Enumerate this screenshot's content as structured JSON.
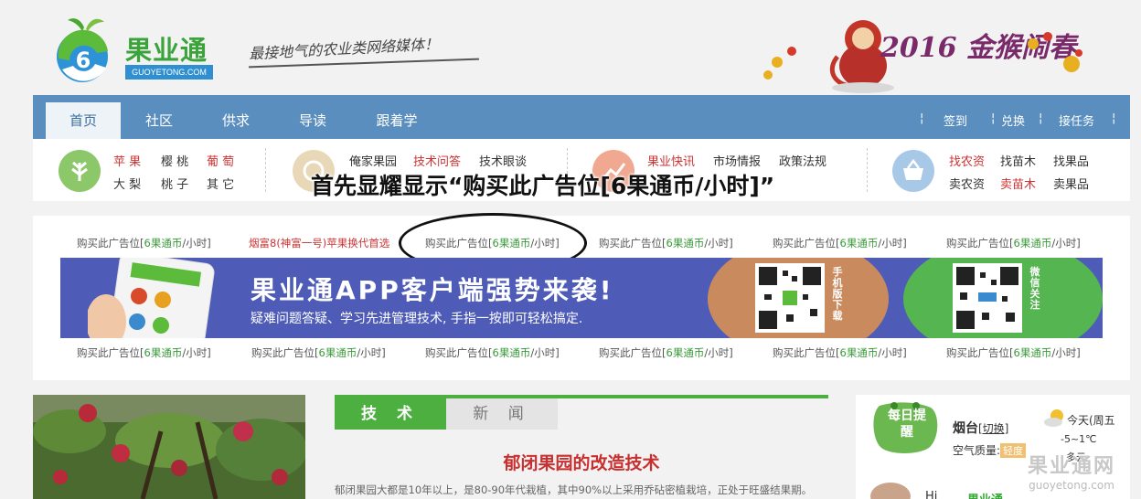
{
  "header": {
    "logo_name": "果业通",
    "logo_domain": "GUOYETONG.COM",
    "slogan": "最接地气的农业类网络媒体！",
    "festive_text": "2016 金猴闹春"
  },
  "nav": {
    "items": [
      {
        "label": "首页",
        "active": true
      },
      {
        "label": "社区"
      },
      {
        "label": "供求"
      },
      {
        "label": "导读"
      },
      {
        "label": "跟着学"
      }
    ],
    "right": [
      "签到",
      "兑换",
      "接任务"
    ]
  },
  "categories": {
    "group1": [
      "苹 果",
      "樱 桃",
      "葡 萄",
      "大 梨",
      "桃 子",
      "其 它"
    ],
    "group2": [
      "俺家果园",
      "技术问答",
      "技术眼谈"
    ],
    "group3": [
      "果业快讯",
      "市场情报",
      "政策法规"
    ],
    "group4": [
      "找农资",
      "找苗木",
      "找果品",
      "卖农资",
      "卖苗木",
      "卖果品"
    ]
  },
  "overlay_caption": "首先显耀显示“购买此广告位[6果通币/小时]”",
  "ads": {
    "prefix": "购买此广告位[",
    "coin": "6果通币",
    "suffix": "/小时]",
    "special": "烟富8(神富一号)苹果换代首选"
  },
  "banner": {
    "title": "果业通APP客户端强势来袭!",
    "subtitle": "疑难问题答疑、学习先进管理技术, 手指一按即可轻松搞定.",
    "mobile_label": "手机版下载",
    "wechat_label": "微信关注"
  },
  "tabs": {
    "tech": "技 术",
    "news": "新 闻"
  },
  "article": {
    "title": "郁闭果园的改造技术",
    "text": "郁闭果园大都是10年以上，是80-90年代栽植，其中90%以上采用乔砧密植栽培，正处于旺盛结果期。"
  },
  "sidebar": {
    "daily": "每日提醒",
    "city": "烟台",
    "switch": "[切换]",
    "air_label": "空气质量:",
    "air_value": "轻度",
    "today": "今天(周五",
    "temp": "-5~1℃",
    "cond": "多云",
    "hi": "Hi",
    "brand": "果业通"
  },
  "watermark": {
    "cn": "果业通网",
    "en": "guoyetong.com"
  }
}
